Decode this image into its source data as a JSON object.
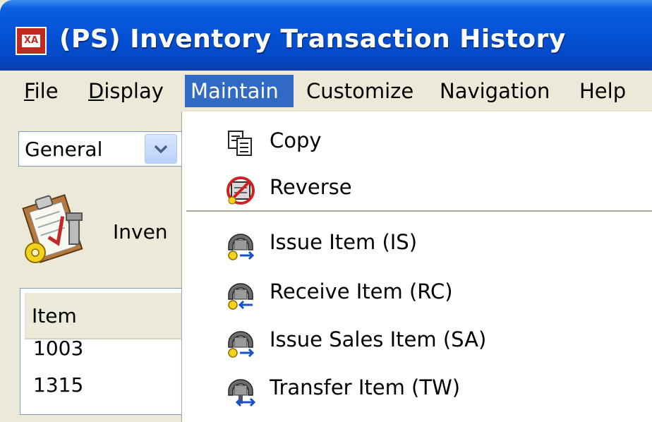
{
  "window": {
    "app_icon_text": "XA",
    "title": "(PS) Inventory Transaction History"
  },
  "menubar": {
    "items": [
      {
        "label_first": "F",
        "label_rest": "ile"
      },
      {
        "label_first": "D",
        "label_rest": "isplay"
      },
      {
        "label": "Maintain",
        "active": true
      },
      {
        "label": "Customize"
      },
      {
        "label": "Navigation"
      },
      {
        "label": "Help"
      }
    ]
  },
  "left_panel": {
    "view_select": {
      "value": "General"
    },
    "task_label": "Inven",
    "grid": {
      "header": "Item",
      "rows": [
        "1003",
        "1315"
      ]
    }
  },
  "maintain_menu": {
    "items": [
      {
        "label": "Copy",
        "icon": "copy-icon"
      },
      {
        "label": "Reverse",
        "icon": "reverse-icon"
      },
      {
        "label": "Issue Item (IS)",
        "icon": "issue-item-icon"
      },
      {
        "label": "Receive Item (RC)",
        "icon": "receive-item-icon"
      },
      {
        "label": "Issue Sales Item (SA)",
        "icon": "issue-sales-item-icon"
      },
      {
        "label": "Transfer Item (TW)",
        "icon": "transfer-item-icon"
      }
    ]
  },
  "colors": {
    "title_bar": "#0453d6",
    "menu_highlight": "#316ac5",
    "menu_bar": "#ece9d8",
    "app_icon": "#c32a1f"
  }
}
